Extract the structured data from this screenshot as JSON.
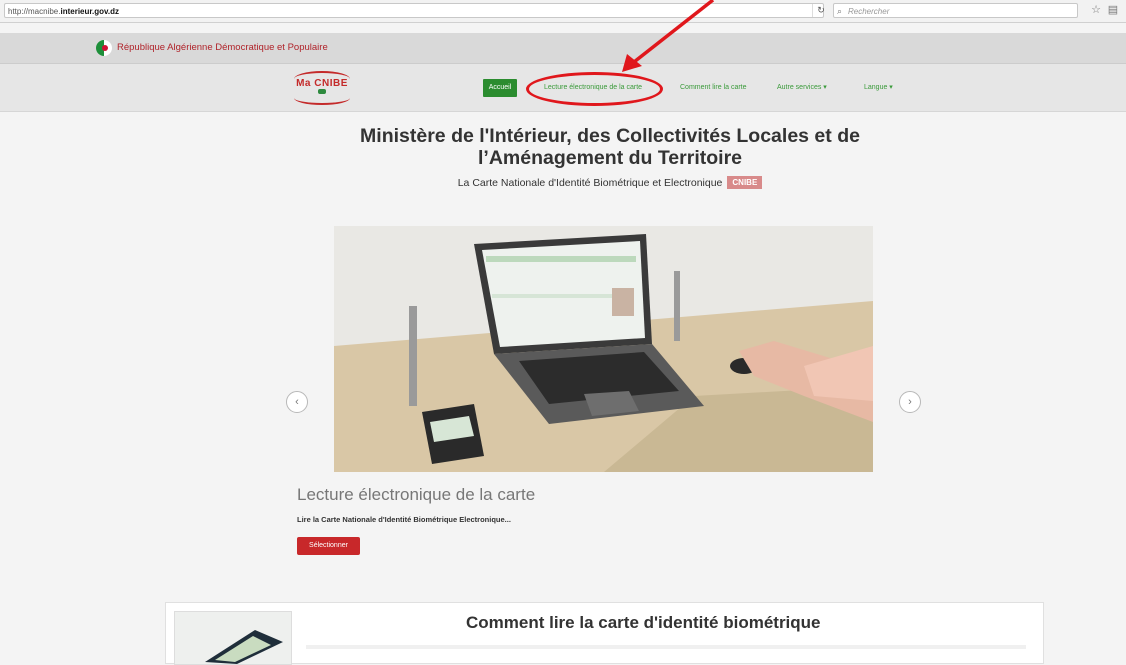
{
  "browser": {
    "url_prefix": "http://macnibe.",
    "url_domain": "interieur.gov.dz",
    "reload_icon": "reload-icon",
    "search_placeholder": "Rechercher",
    "search_icon": "search-icon",
    "toolbar_icons": [
      "star-icon",
      "clipboard-icon"
    ]
  },
  "header": {
    "republic_name": "République Algérienne Démocratique et Populaire",
    "flag_icon": "algeria-flag-icon"
  },
  "nav": {
    "logo_text": "Ma CNIBE",
    "items": [
      {
        "label": "Accueil",
        "active": true
      },
      {
        "label": "Lecture électronique de la carte"
      },
      {
        "label": "Comment lire la carte"
      },
      {
        "label": "Autre services ▾"
      },
      {
        "label": "Langue ▾"
      }
    ]
  },
  "main": {
    "ministry_line1": "Ministère de l'Intérieur, des Collectivités Locales et de",
    "ministry_line2": "l’Aménagement du Territoire",
    "subtitle": "La Carte Nationale d'Identité Biométrique et Electronique",
    "badge": "CNIBE"
  },
  "carousel": {
    "prev_icon": "chevron-left-icon",
    "next_icon": "chevron-right-icon",
    "prev_glyph": "‹",
    "next_glyph": "›",
    "caption_title": "Lecture électronique de la carte",
    "caption_text": "Lire la Carte Nationale d'Identité Biométrique Electronique...",
    "button_label": "Sélectionner"
  },
  "card": {
    "title": "Comment lire la carte d'identité biométrique"
  },
  "colors": {
    "accent_green": "#2b8c2f",
    "link_green": "#3a9a3a",
    "button_red": "#c8282a",
    "annotation_red": "#e0171c"
  }
}
